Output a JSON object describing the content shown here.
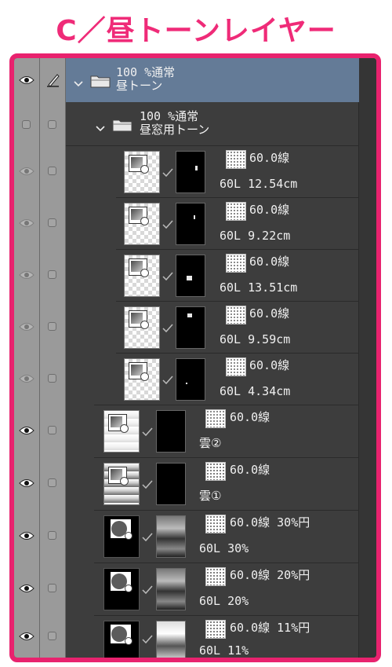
{
  "title": "C／昼トーンレイヤー",
  "colors": {
    "accent": "#e8226e",
    "title": "#ef2b78",
    "panel": "#3d3d3d",
    "selected": "#647b97"
  },
  "folders": [
    {
      "line1": "100 %通常",
      "line2": "昼トーン",
      "icon": "folder-icon"
    },
    {
      "line1": "100 %通常",
      "line2": "昼窓用トーン",
      "icon": "folder-icon"
    }
  ],
  "layers": [
    {
      "tone": "60.0線",
      "info": "60L 12.54cm"
    },
    {
      "tone": "60.0線",
      "info": "60L 9.22cm"
    },
    {
      "tone": "60.0線",
      "info": "60L 13.51cm"
    },
    {
      "tone": "60.0線",
      "info": "60L 9.59cm"
    },
    {
      "tone": "60.0線",
      "info": "60L 4.34cm"
    },
    {
      "tone": "60.0線",
      "info": "雲②"
    },
    {
      "tone": "60.0線",
      "info": "雲①"
    },
    {
      "tone": "60.0線 30%円",
      "info": "60L 30%"
    },
    {
      "tone": "60.0線 20%円",
      "info": "60L 20%"
    },
    {
      "tone": "60.0線 11%円",
      "info": "60L 11%"
    }
  ]
}
